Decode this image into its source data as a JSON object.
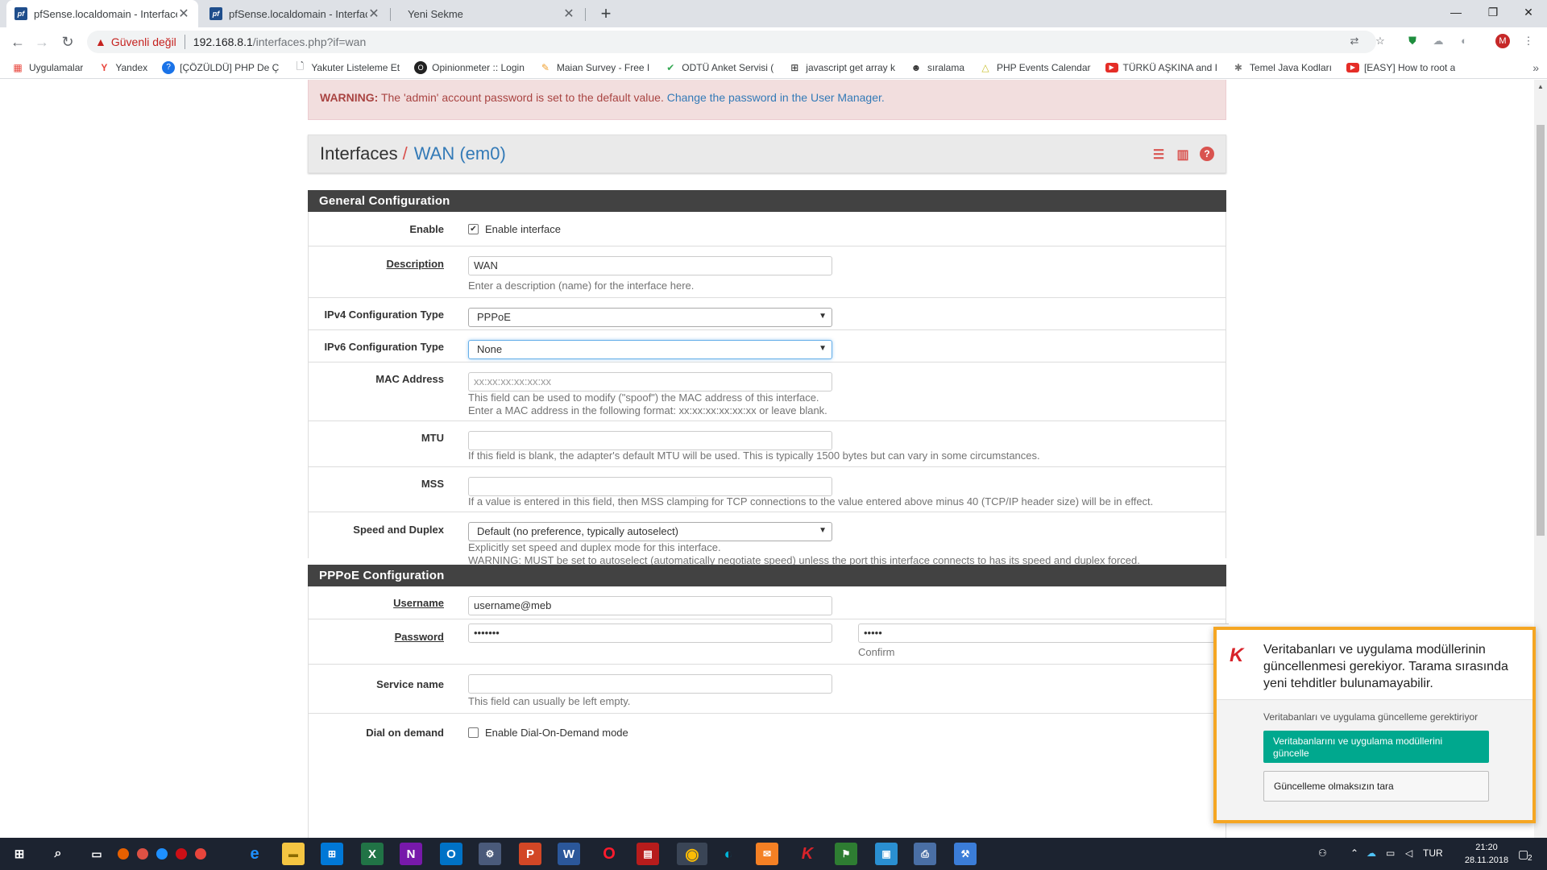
{
  "browser": {
    "tabs": [
      {
        "title": "pfSense.localdomain - Interfaces",
        "favicon": "pf",
        "active": true
      },
      {
        "title": "pfSense.localdomain - Interfaces",
        "favicon": "pf",
        "active": false
      },
      {
        "title": "Yeni Sekme",
        "favicon": "",
        "active": false
      }
    ],
    "close_glyph": "✕",
    "new_tab_glyph": "+",
    "window": {
      "minimize": "—",
      "restore": "❐",
      "close": "✕"
    },
    "security_label": "Güvenli değil",
    "url_host": "192.168.8.1",
    "url_path": "/interfaces.php?if=wan",
    "profile_initial": "M",
    "bookmarks": [
      {
        "label": "Uygulamalar",
        "icon": "apps-grid-icon",
        "color": "#e8453c"
      },
      {
        "label": "Yandex",
        "icon": "yandex-icon",
        "color": "#e8453c"
      },
      {
        "label": "[ÇÖZÜLDÜ] PHP De Ç",
        "icon": "help-circle-icon",
        "color": "#1a73e8"
      },
      {
        "label": "Yakuter Listeleme Et",
        "icon": "page-icon",
        "color": "#5f6368"
      },
      {
        "label": "Opinionmeter :: Login",
        "icon": "opinionmeter-icon",
        "color": "#222222"
      },
      {
        "label": "Maian Survey - Free I",
        "icon": "pencil-icon",
        "color": "#f0a030"
      },
      {
        "label": "ODTÜ Anket Servisi (",
        "icon": "check-icon",
        "color": "#34a853"
      },
      {
        "label": "javascript get array k",
        "icon": "grid-icon",
        "color": "#222222"
      },
      {
        "label": "sıralama",
        "icon": "avatar-icon",
        "color": "#333333"
      },
      {
        "label": "PHP Events Calendar",
        "icon": "triangle-icon",
        "color": "#c9c02e"
      },
      {
        "label": "TÜRKÜ AŞKINA and I",
        "icon": "youtube-icon",
        "color": "#e52d27"
      },
      {
        "label": "Temel Java Kodları",
        "icon": "gear-icon",
        "color": "#777777"
      },
      {
        "label": "[EASY] How to root a",
        "icon": "youtube-icon",
        "color": "#e52d27"
      }
    ],
    "bookmarks_more": "»"
  },
  "alert": {
    "prefix": "WARNING:",
    "text": " The 'admin' account password is set to the default value. ",
    "link": "Change the password in the User Manager."
  },
  "breadcrumb": {
    "root": "Interfaces",
    "separator": "/",
    "current": "WAN (em0)",
    "tool_icons": [
      "sliders-icon",
      "bar-chart-icon",
      "help-icon"
    ]
  },
  "general": {
    "heading": "General Configuration",
    "enable_label": "Enable",
    "enable_checkbox_label": "Enable interface",
    "enable_checked": true,
    "description_label": "Description",
    "description_value": "WAN",
    "description_help": "Enter a description (name) for the interface here.",
    "ipv4_label": "IPv4 Configuration Type",
    "ipv4_value": "PPPoE",
    "ipv6_label": "IPv6 Configuration Type",
    "ipv6_value": "None",
    "mac_label": "MAC Address",
    "mac_placeholder": "xx:xx:xx:xx:xx:xx",
    "mac_help_1": "This field can be used to modify (\"spoof\") the MAC address of this interface.",
    "mac_help_2": "Enter a MAC address in the following format: xx:xx:xx:xx:xx:xx or leave blank.",
    "mtu_label": "MTU",
    "mtu_value": "",
    "mtu_help": "If this field is blank, the adapter's default MTU will be used. This is typically 1500 bytes but can vary in some circumstances.",
    "mss_label": "MSS",
    "mss_value": "",
    "mss_help": "If a value is entered in this field, then MSS clamping for TCP connections to the value entered above minus 40 (TCP/IP header size) will be in effect.",
    "speed_label": "Speed and Duplex",
    "speed_value": "Default (no preference, typically autoselect)",
    "speed_help_1": "Explicitly set speed and duplex mode for this interface.",
    "speed_help_2": "WARNING: MUST be set to autoselect (automatically negotiate speed) unless the port this interface connects to has its speed and duplex forced."
  },
  "pppoe": {
    "heading": "PPPoE Configuration",
    "username_label": "Username",
    "username_value": "username@meb",
    "password_label": "Password",
    "password_value": "•••••••",
    "confirm_value": "•••••",
    "confirm_label": "Confirm",
    "service_label": "Service name",
    "service_value": "",
    "service_help": "This field can usually be left empty.",
    "dod_label": "Dial on demand",
    "dod_checkbox_label": "Enable Dial-On-Demand mode",
    "dod_checked": false
  },
  "kaspersky": {
    "message": "Veritabanları ve uygulama modüllerinin güncellenmesi gerekiyor. Tarama sırasında yeni tehditler bulunamayabilir.",
    "sub": "Veritabanları ve uygulama güncelleme gerektiriyor",
    "primary_button": "Veritabanlarını ve uygulama modüllerini güncelle",
    "secondary_button": "Güncelleme olmaksızın tara",
    "accent": "#f5a623",
    "button_color": "#00a88e"
  },
  "taskbar": {
    "language": "TUR",
    "time": "21:20",
    "date": "28.11.2018",
    "notification_count": "2"
  },
  "colors": {
    "alert_bg": "#f2dede",
    "alert_text": "#a94442",
    "link": "#337ab7",
    "section_head": "#424242",
    "pf_red": "#d9534f"
  }
}
